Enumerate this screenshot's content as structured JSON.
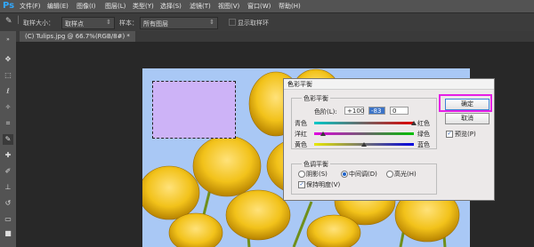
{
  "app": {
    "logo": "Ps"
  },
  "menu": [
    "文件(F)",
    "编辑(E)",
    "图像(I)",
    "图层(L)",
    "类型(Y)",
    "选择(S)",
    "滤镜(T)",
    "视图(V)",
    "窗口(W)",
    "帮助(H)"
  ],
  "options_bar": {
    "sample_size_label": "取样大小：",
    "sample_size_value": "取样点",
    "sample_label": "样本：",
    "sample_value": "所有图层",
    "show_ring_label": "显示取样环"
  },
  "document_tab": "(C) Tulips.jpg @ 66.7%(RGB/8#) *",
  "dialog": {
    "title": "色彩平衡",
    "close": "×",
    "balance_group": "色彩平衡",
    "levels_label": "色阶(L):",
    "levels": [
      "+100",
      "-83",
      "0"
    ],
    "sliders": [
      {
        "left": "青色",
        "right": "红色",
        "value": 100
      },
      {
        "left": "洋红",
        "right": "绿色",
        "value": -83
      },
      {
        "left": "黄色",
        "right": "蓝色",
        "value": 0
      }
    ],
    "tone_group": "色调平衡",
    "shadows": "阴影(S)",
    "midtones": "中间调(D)",
    "highlights": "高光(H)",
    "preserve_luminosity": "保持明度(V)",
    "ok": "确定",
    "cancel": "取消",
    "preview": "预览(P)"
  },
  "colors": {
    "annotation": "#e61ee6",
    "selection_fill": "#cdb3f7"
  }
}
